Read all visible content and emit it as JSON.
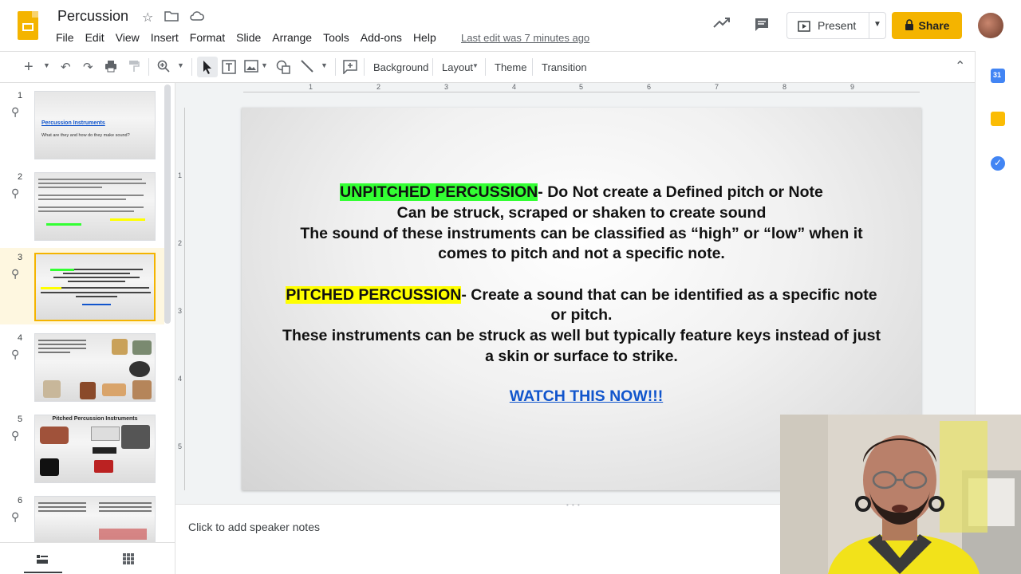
{
  "app": {
    "doc_title": "Percussion",
    "last_edit": "Last edit was 7 minutes ago",
    "present_label": "Present",
    "share_label": "Share"
  },
  "menu": [
    "File",
    "Edit",
    "View",
    "Insert",
    "Format",
    "Slide",
    "Arrange",
    "Tools",
    "Add-ons",
    "Help"
  ],
  "toolbar": {
    "background_label": "Background",
    "layout_label": "Layout",
    "theme_label": "Theme",
    "transition_label": "Transition"
  },
  "filmstrip": {
    "slides": [
      {
        "number": "1",
        "title": "Percussion Instruments",
        "subtitle": "What are they and how do they make sound?"
      },
      {
        "number": "2"
      },
      {
        "number": "3",
        "active": true
      },
      {
        "number": "4"
      },
      {
        "number": "5",
        "title": "Pitched Percussion Instruments"
      },
      {
        "number": "6"
      }
    ]
  },
  "ruler": {
    "h_ticks": [
      "1",
      "2",
      "3",
      "4",
      "5",
      "6",
      "7",
      "8",
      "9"
    ],
    "v_ticks": [
      "1",
      "2",
      "3",
      "4",
      "5"
    ]
  },
  "slide": {
    "unpitched_label": "UNPITCHED PERCUSSION",
    "unpitched_rest": "- Do Not create a Defined pitch or Note",
    "line2": "Can be struck, scraped or shaken to create sound",
    "line3": "The sound of these instruments can be classified as “high” or “low” when it",
    "line4": "comes to pitch and not a specific note.",
    "pitched_label": "PITCHED PERCUSSION",
    "pitched_rest": "- Create a sound that can be identified as a specific note",
    "line6": "or pitch.",
    "line7": "These instruments can be struck as well but typically feature keys instead of just",
    "line8": "a skin or surface to strike.",
    "link": "WATCH THIS NOW!!!"
  },
  "notes": {
    "placeholder": "Click to add speaker notes"
  },
  "colors": {
    "accent": "#f4b400",
    "highlight_green": "#33ff33",
    "highlight_yellow": "#ffff00",
    "link": "#1155cc"
  }
}
